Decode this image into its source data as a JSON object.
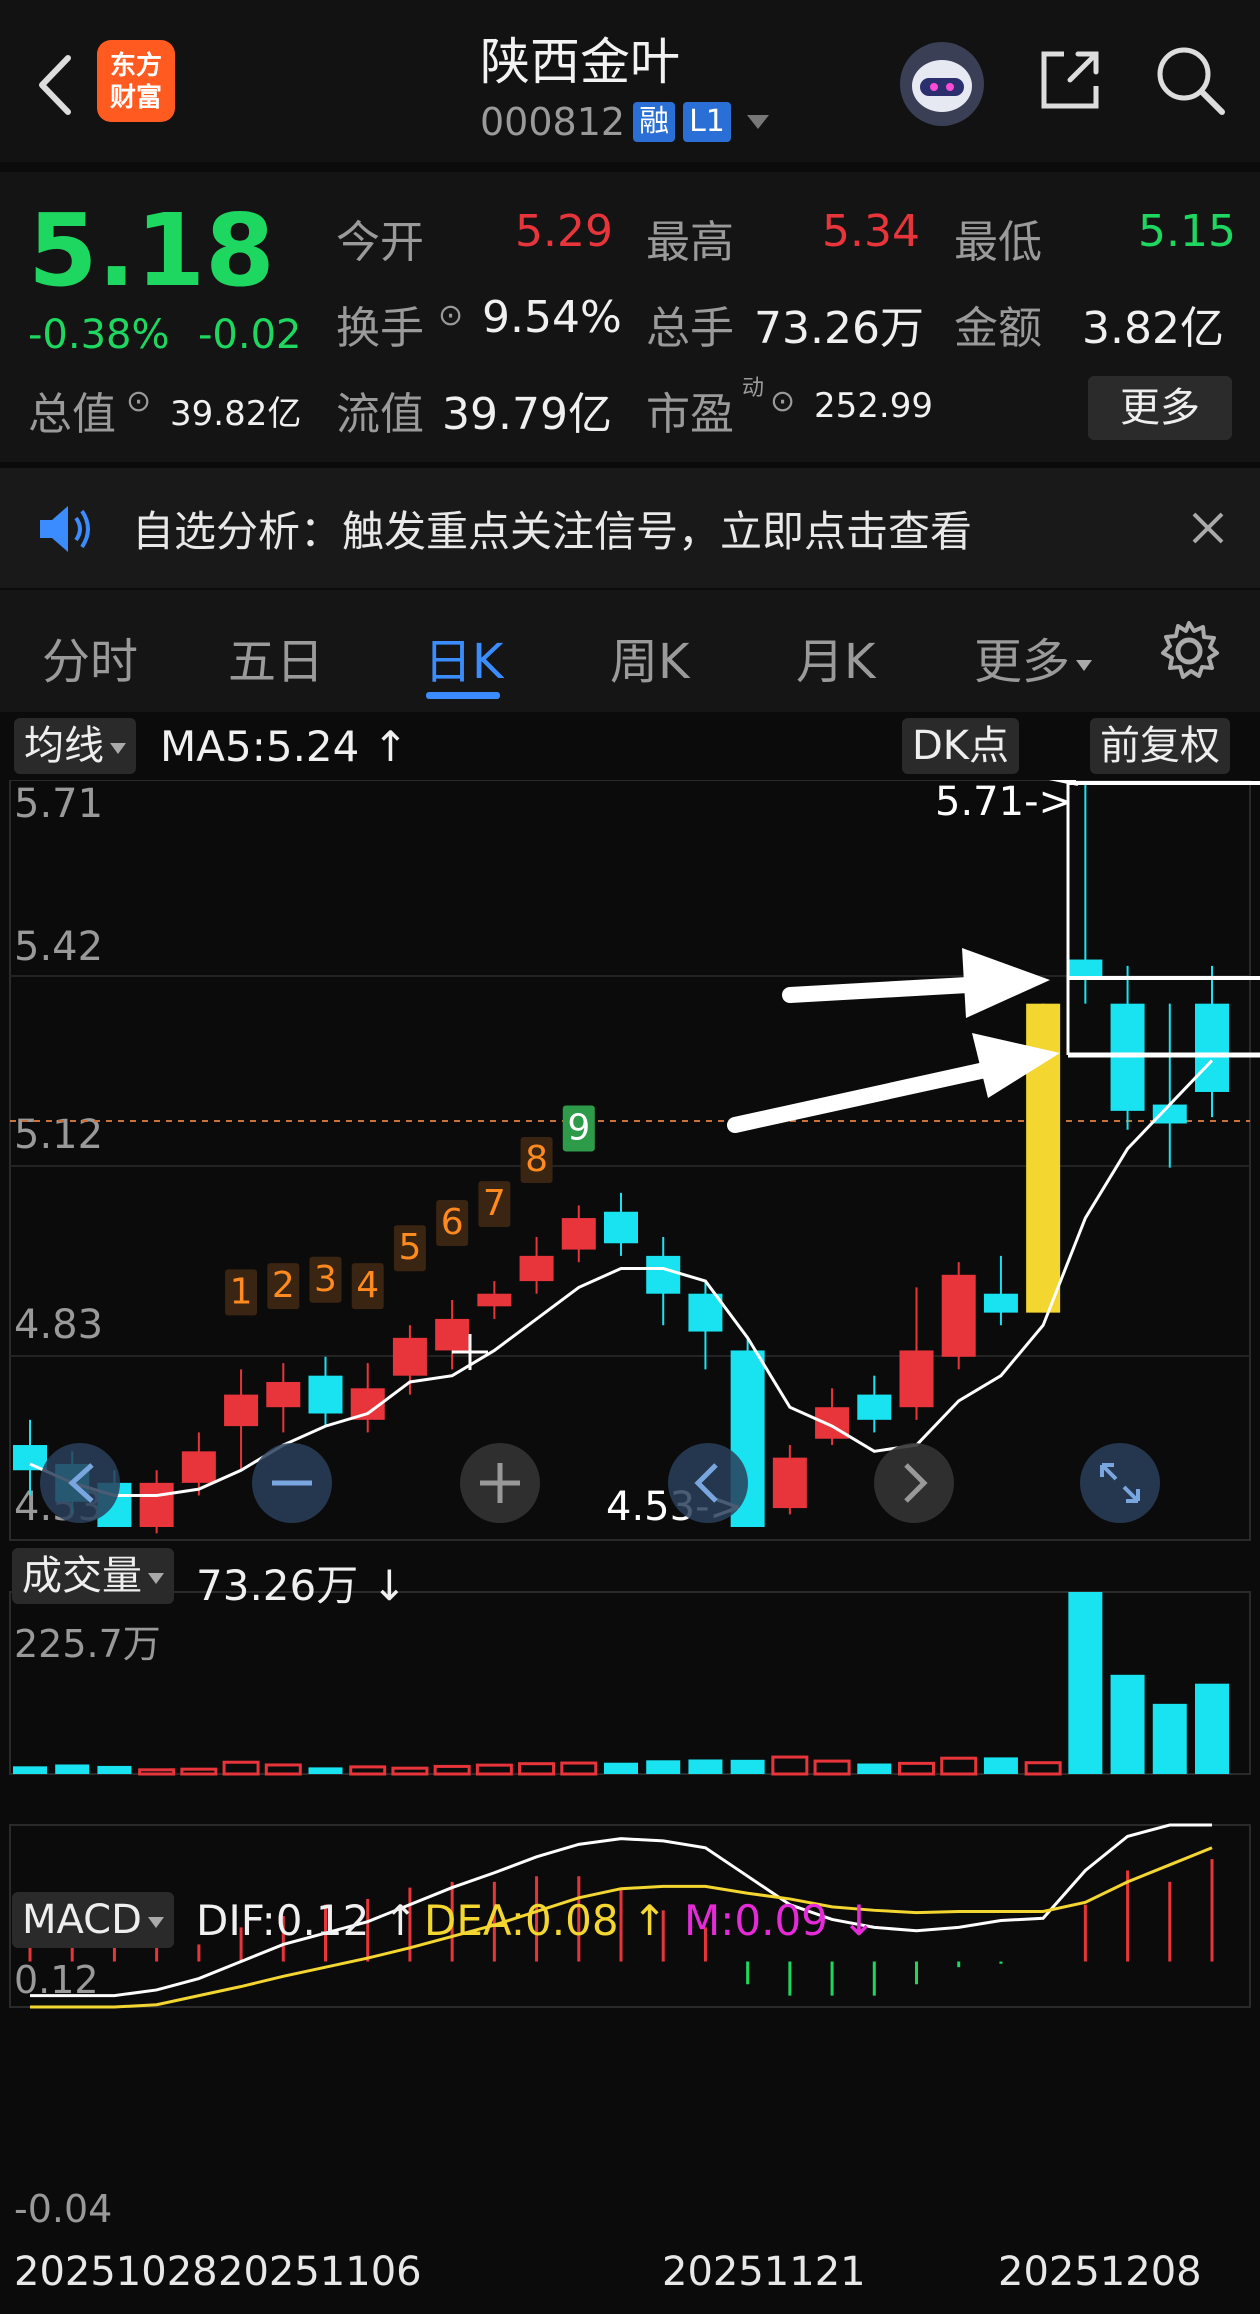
{
  "header": {
    "stock_name": "陕西金叶",
    "stock_code": "000812",
    "badge_margin": "融",
    "badge_level": "L1",
    "logo_line1": "东方",
    "logo_line2": "财富"
  },
  "quote": {
    "price": "5.18",
    "change_pct": "-0.38%",
    "change": "-0.02",
    "open_label": "今开",
    "open": "5.29",
    "high_label": "最高",
    "high": "5.34",
    "low_label": "最低",
    "low": "5.15",
    "turnover_label": "换手",
    "turnover": "9.54%",
    "volume_label": "总手",
    "volume": "73.26万",
    "amount_label": "金额",
    "amount": "3.82亿",
    "mktcap_label": "总值",
    "mktcap": "39.82亿",
    "float_label": "流值",
    "float": "39.79亿",
    "pe_label": "市盈",
    "pe_sup": "动",
    "pe": "252.99",
    "more_button": "更多"
  },
  "banner": {
    "text": "自选分析：触发重点关注信号，立即点击查看"
  },
  "tabs": [
    "分时",
    "五日",
    "日K",
    "周K",
    "月K",
    "更多"
  ],
  "active_tab": "日K",
  "kline": {
    "ma_selector": "均线",
    "ma5": "MA5:5.24 ↑",
    "dk_label": "DK点",
    "adjust_button": "前复权",
    "y_labels": [
      "5.71",
      "5.42",
      "5.12",
      "4.83",
      "4.53"
    ],
    "high_marker": "5.71->",
    "low_marker": "4.53->",
    "seq_numbers": [
      "1",
      "2",
      "3",
      "4",
      "5",
      "6",
      "7",
      "8",
      "9"
    ]
  },
  "volume": {
    "selector": "成交量",
    "value": "73.26万 ↓",
    "y_max": "225.7万"
  },
  "macd": {
    "selector": "MACD",
    "dif": "DIF:0.12 ↑",
    "dea": "DEA:0.08 ↑",
    "m": "M:0.09 ↓",
    "y_top": "0.12",
    "y_bottom": "-0.04"
  },
  "x_labels": [
    "20251028",
    "20251106",
    "20251121",
    "20251208"
  ],
  "colors": {
    "up": "#e8353b",
    "down": "#19e3f0",
    "ma5": "#ffffff",
    "dea": "#f4d631",
    "m": "#e52bd8",
    "limit_up": "#f4d631",
    "accent": "#3b8dff"
  },
  "chart_data": {
    "type": "candlestick",
    "series": [
      {
        "name": "K",
        "values": [
          {
            "o": 4.66,
            "c": 4.62,
            "h": 4.7,
            "l": 4.58
          },
          {
            "o": 4.63,
            "c": 4.57,
            "h": 4.65,
            "l": 4.55
          },
          {
            "o": 4.6,
            "c": 4.53,
            "h": 4.62,
            "l": 4.53
          },
          {
            "o": 4.53,
            "c": 4.6,
            "h": 4.62,
            "l": 4.52
          },
          {
            "o": 4.6,
            "c": 4.65,
            "h": 4.68,
            "l": 4.58
          },
          {
            "o": 4.69,
            "c": 4.74,
            "h": 4.78,
            "l": 4.62
          },
          {
            "o": 4.72,
            "c": 4.76,
            "h": 4.79,
            "l": 4.68
          },
          {
            "o": 4.77,
            "c": 4.71,
            "h": 4.8,
            "l": 4.69
          },
          {
            "o": 4.7,
            "c": 4.75,
            "h": 4.79,
            "l": 4.68
          },
          {
            "o": 4.77,
            "c": 4.83,
            "h": 4.85,
            "l": 4.74
          },
          {
            "o": 4.81,
            "c": 4.86,
            "h": 4.89,
            "l": 4.78
          },
          {
            "o": 4.88,
            "c": 4.9,
            "h": 4.92,
            "l": 4.86
          },
          {
            "o": 4.92,
            "c": 4.96,
            "h": 4.99,
            "l": 4.9
          },
          {
            "o": 4.97,
            "c": 5.02,
            "h": 5.04,
            "l": 4.95
          },
          {
            "o": 5.03,
            "c": 4.98,
            "h": 5.06,
            "l": 4.96
          },
          {
            "o": 4.96,
            "c": 4.9,
            "h": 4.99,
            "l": 4.85
          },
          {
            "o": 4.9,
            "c": 4.84,
            "h": 4.92,
            "l": 4.78
          },
          {
            "o": 4.81,
            "c": 4.53,
            "h": 4.83,
            "l": 4.53
          },
          {
            "o": 4.56,
            "c": 4.64,
            "h": 4.66,
            "l": 4.55
          },
          {
            "o": 4.67,
            "c": 4.72,
            "h": 4.75,
            "l": 4.66
          },
          {
            "o": 4.74,
            "c": 4.7,
            "h": 4.77,
            "l": 4.68
          },
          {
            "o": 4.72,
            "c": 4.81,
            "h": 4.91,
            "l": 4.7
          },
          {
            "o": 4.8,
            "c": 4.93,
            "h": 4.95,
            "l": 4.78
          },
          {
            "o": 4.9,
            "c": 4.87,
            "h": 4.96,
            "l": 4.85
          },
          {
            "o": 4.87,
            "c": 5.36,
            "h": 5.36,
            "l": 4.87
          },
          {
            "o": 5.43,
            "c": 5.4,
            "h": 5.71,
            "l": 5.36
          },
          {
            "o": 5.36,
            "c": 5.19,
            "h": 5.42,
            "l": 5.16
          },
          {
            "o": 5.2,
            "c": 5.17,
            "h": 5.36,
            "l": 5.1
          },
          {
            "o": 5.36,
            "c": 5.22,
            "h": 5.42,
            "l": 5.18
          }
        ]
      },
      {
        "name": "MA5",
        "values": [
          4.63,
          4.6,
          4.58,
          4.58,
          4.59,
          4.62,
          4.66,
          4.69,
          4.71,
          4.76,
          4.77,
          4.81,
          4.86,
          4.91,
          4.94,
          4.94,
          4.92,
          4.83,
          4.72,
          4.69,
          4.65,
          4.66,
          4.73,
          4.77,
          4.85,
          5.02,
          5.13,
          5.2,
          5.27
        ]
      }
    ],
    "volume": [
      95000,
      118000,
      100000,
      52000,
      60000,
      146000,
      112000,
      82000,
      88000,
      72000,
      94000,
      110000,
      128000,
      136000,
      140000,
      170000,
      180000,
      176000,
      210000,
      160000,
      130000,
      132000,
      196000,
      206000,
      140000,
      2257000,
      1230000,
      870000,
      1120000
    ],
    "macd_dif": [
      -0.03,
      -0.03,
      -0.03,
      -0.025,
      -0.015,
      0.0,
      0.015,
      0.025,
      0.035,
      0.05,
      0.065,
      0.078,
      0.092,
      0.103,
      0.108,
      0.106,
      0.1,
      0.075,
      0.05,
      0.037,
      0.03,
      0.027,
      0.03,
      0.036,
      0.038,
      0.08,
      0.11,
      0.12,
      0.12
    ],
    "macd_dea": [
      -0.04,
      -0.04,
      -0.04,
      -0.038,
      -0.03,
      -0.022,
      -0.013,
      -0.005,
      0.003,
      0.012,
      0.022,
      0.032,
      0.044,
      0.056,
      0.064,
      0.066,
      0.066,
      0.06,
      0.055,
      0.048,
      0.045,
      0.043,
      0.044,
      0.044,
      0.044,
      0.052,
      0.07,
      0.085,
      0.1
    ],
    "macd_m": [
      0.04,
      0.04,
      0.03,
      0.02,
      0.015,
      0.03,
      0.04,
      0.05,
      0.055,
      0.065,
      0.07,
      0.07,
      0.075,
      0.075,
      0.065,
      0.045,
      0.03,
      -0.02,
      -0.03,
      -0.03,
      -0.03,
      -0.02,
      -0.005,
      -0.002,
      0.0,
      0.05,
      0.08,
      0.07,
      0.09
    ]
  }
}
